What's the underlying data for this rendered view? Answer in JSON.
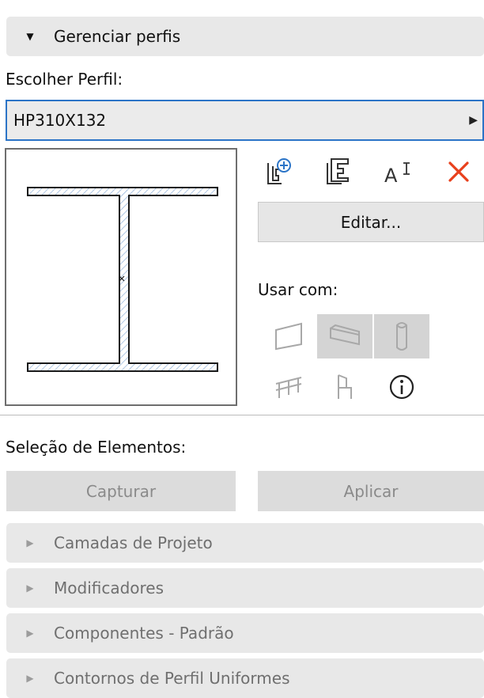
{
  "manage_profiles": {
    "title": "Gerenciar perfis",
    "expanded": true
  },
  "choose_profile": {
    "label": "Escolher Perfil:",
    "selected": "HP310X132"
  },
  "toolbar": {
    "icons": [
      "new-profile-icon",
      "duplicate-profile-icon",
      "rename-profile-icon",
      "delete-profile-icon"
    ],
    "delete_color": "#e8401c",
    "edit_label": "Editar..."
  },
  "use_with": {
    "label": "Usar com:",
    "items": [
      {
        "icon": "wall-icon",
        "active": false
      },
      {
        "icon": "beam-icon",
        "active": true
      },
      {
        "icon": "column-icon",
        "active": true
      },
      {
        "icon": "railing-icon",
        "active": false
      },
      {
        "icon": "object-icon",
        "active": false
      },
      {
        "icon": "info-icon",
        "active": false
      }
    ]
  },
  "element_selection": {
    "label": "Seleção de Elementos:",
    "capture_label": "Capturar",
    "apply_label": "Aplicar"
  },
  "collapsed_sections": [
    {
      "title": "Camadas de Projeto"
    },
    {
      "title": "Modificadores"
    },
    {
      "title": "Componentes - Padrão"
    },
    {
      "title": "Contornos de Perfil Uniformes"
    }
  ]
}
